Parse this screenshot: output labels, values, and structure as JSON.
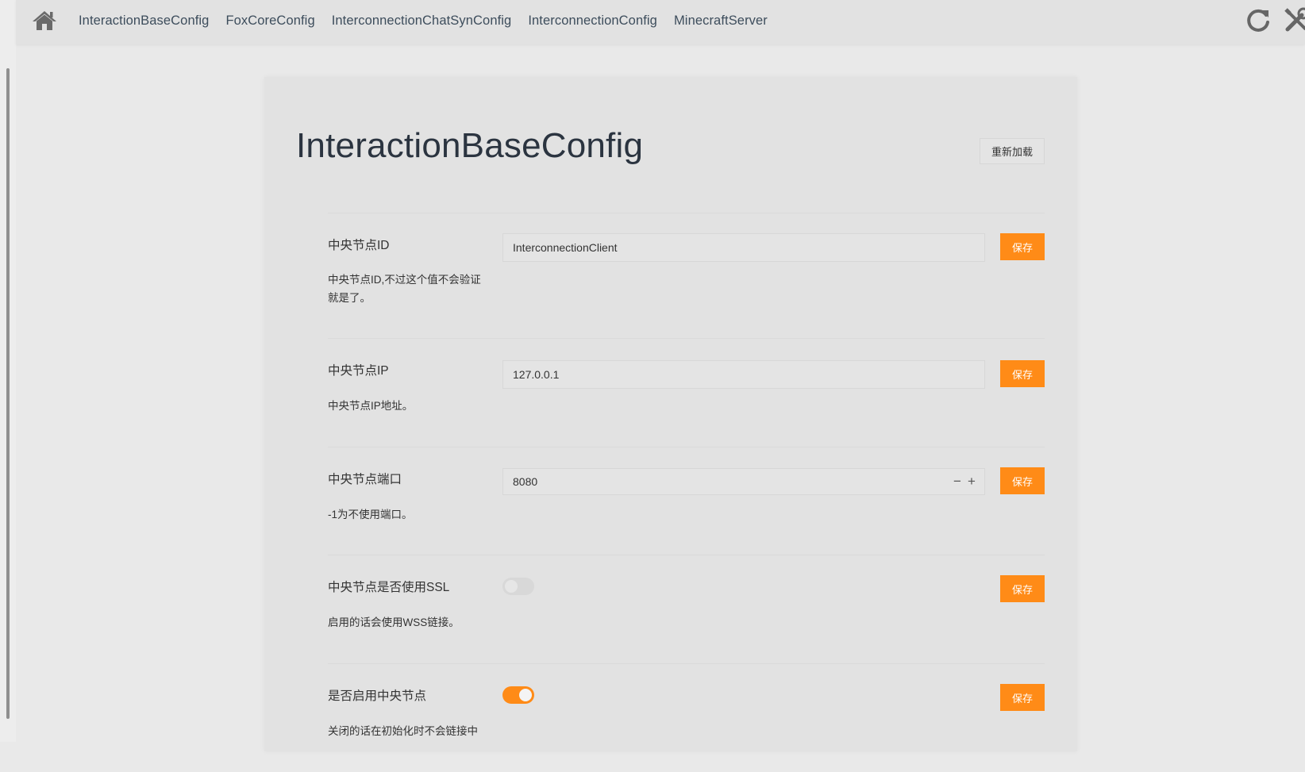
{
  "nav": {
    "items": [
      {
        "label": "InteractionBaseConfig"
      },
      {
        "label": "FoxCoreConfig"
      },
      {
        "label": "InterconnectionChatSynConfig"
      },
      {
        "label": "InterconnectionConfig"
      },
      {
        "label": "MinecraftServer"
      }
    ],
    "icons": {
      "home": "home-icon",
      "reload": "reload-icon",
      "tools": "tools-icon"
    }
  },
  "page": {
    "title": "InteractionBaseConfig",
    "reload_label": "重新加载"
  },
  "colors": {
    "accent": "#ff8b17",
    "background": "#e9e9e9",
    "card": "#e2e2e2",
    "nav_text": "#3d4d5c"
  },
  "config": [
    {
      "title": "中央节点ID",
      "description": "中央节点ID,不过这个值不会验证就是了。",
      "type": "text",
      "value": "InterconnectionClient",
      "save_label": "保存"
    },
    {
      "title": "中央节点IP",
      "description": "中央节点IP地址。",
      "type": "text",
      "value": "127.0.0.1",
      "save_label": "保存"
    },
    {
      "title": "中央节点端口",
      "description": "-1为不使用端口。",
      "type": "number",
      "value": "8080",
      "decrement": "−",
      "increment": "+",
      "save_label": "保存"
    },
    {
      "title": "中央节点是否使用SSL",
      "description": "启用的话会使用WSS链接。",
      "type": "toggle",
      "enabled": false,
      "save_label": "保存"
    },
    {
      "title": "是否启用中央节点",
      "description": "关闭的话在初始化时不会链接中",
      "type": "toggle",
      "enabled": true,
      "save_label": "保存"
    }
  ]
}
